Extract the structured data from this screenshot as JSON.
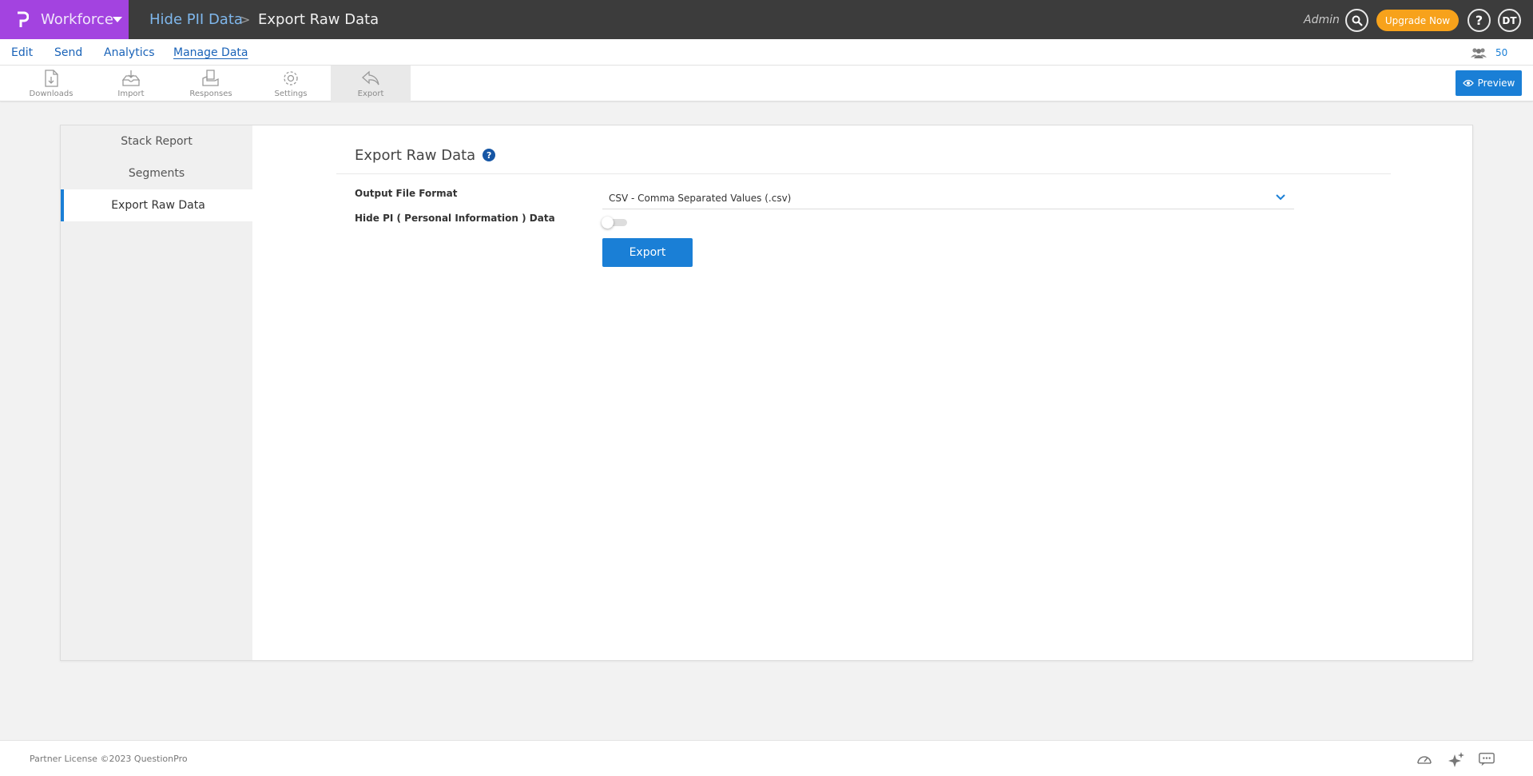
{
  "header": {
    "brand": "Workforce",
    "breadcrumb": [
      "Hide PII Data",
      "Export Raw Data"
    ],
    "breadcrumb_separator": ">",
    "user_role": "Admin",
    "upgrade_label": "Upgrade Now",
    "help_label": "?",
    "user_initials": "DT"
  },
  "menu": {
    "items": [
      "Edit",
      "Send",
      "Analytics",
      "Manage Data"
    ],
    "active": "Manage Data",
    "participant_count": "50"
  },
  "toolbar": {
    "tools": [
      "Downloads",
      "Import",
      "Responses",
      "Settings",
      "Export"
    ],
    "active": "Export",
    "preview_label": "Preview"
  },
  "sidebar": {
    "items": [
      "Stack Report",
      "Segments",
      "Export Raw Data"
    ],
    "active": "Export Raw Data"
  },
  "main": {
    "title": "Export Raw Data",
    "help_icon": "?",
    "output_format_label": "Output File Format",
    "output_format_value": "CSV - Comma Separated Values (.csv)",
    "hide_pi_label": "Hide PI ( Personal Information ) Data",
    "hide_pi_enabled": false,
    "export_label": "Export"
  },
  "footer": {
    "copyright": "Partner License ©2023 QuestionPro"
  },
  "colors": {
    "brand_purple": "#a343e0",
    "topbar": "#3c3c3c",
    "accent_blue": "#1a7fd6",
    "upgrade_orange": "#f7a21b"
  }
}
